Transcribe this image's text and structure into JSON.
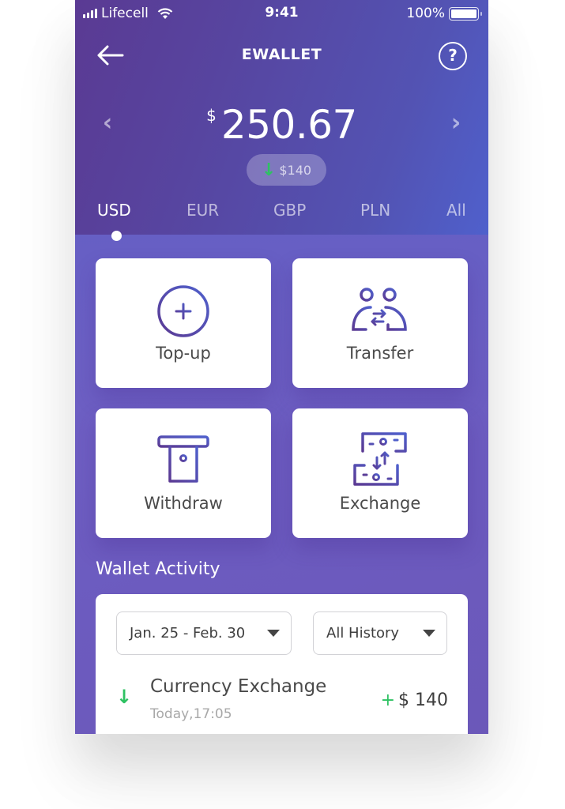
{
  "status_bar": {
    "carrier": "Lifecell",
    "time": "9:41",
    "battery": "100%"
  },
  "nav": {
    "title": "EWALLET",
    "back_icon": "arrow-left-icon",
    "help_icon": "question-circle-icon",
    "help_glyph": "?"
  },
  "balance": {
    "currency_symbol": "$",
    "amount": "250.67",
    "prev_glyph": "‹",
    "next_glyph": "›",
    "delta_arrow": "↓",
    "delta": "$140"
  },
  "currency_tabs": [
    {
      "label": "USD",
      "active": true
    },
    {
      "label": "EUR",
      "active": false
    },
    {
      "label": "GBP",
      "active": false
    },
    {
      "label": "PLN",
      "active": false
    },
    {
      "label": "All",
      "active": false
    }
  ],
  "actions": [
    {
      "label": "Top-up",
      "icon": "plus-circle-icon"
    },
    {
      "label": "Transfer",
      "icon": "transfer-users-icon"
    },
    {
      "label": "Withdraw",
      "icon": "atm-withdraw-icon"
    },
    {
      "label": "Exchange",
      "icon": "exchange-bills-icon"
    }
  ],
  "wallet_activity": {
    "title": "Wallet Activity",
    "date_filter": "Jan. 25 - Feb. 30",
    "type_filter": "All History",
    "transactions": [
      {
        "direction_arrow": "↓",
        "name": "Currency Exchange",
        "time": "Today,17:05",
        "sign": "+",
        "amount": "$ 140"
      }
    ]
  },
  "colors": {
    "accent_green": "#2ec262",
    "icon_gradient_start": "#5b3a93",
    "icon_gradient_end": "#4f60cc"
  }
}
